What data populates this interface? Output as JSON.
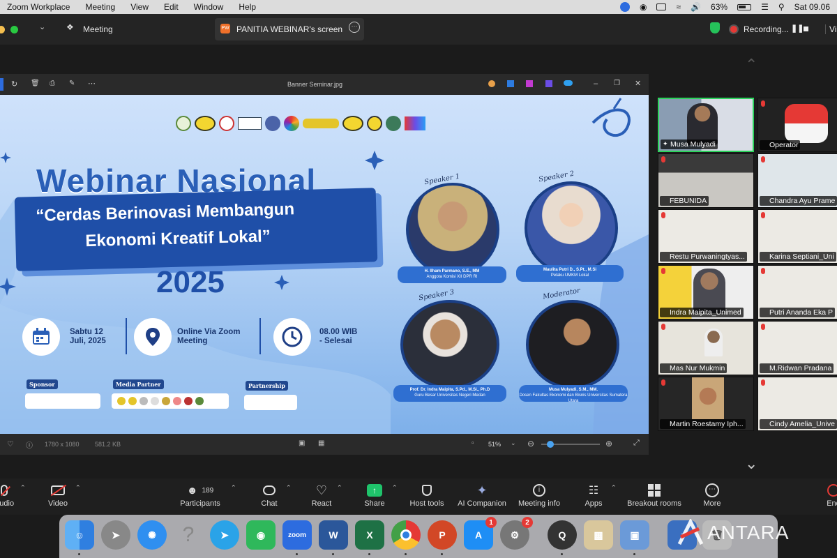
{
  "menubar": {
    "items": [
      "Zoom Workplace",
      "Meeting",
      "View",
      "Edit",
      "Window",
      "Help"
    ],
    "battery": "63%",
    "clock": "Sat 09.06"
  },
  "titlebar": {
    "meeting_label": "Meeting",
    "share_tab": "PANITIA WEBINAR's screen",
    "share_tab_avatar": "PW",
    "recording": "Recording...",
    "view": "View"
  },
  "viewer": {
    "filename": "Banner Seminar.jpg",
    "dimensions": "1780 x 1080",
    "filesize": "581.2 KB",
    "zoom": "51%"
  },
  "banner": {
    "title": "Webinar Nasional",
    "theme_line1": "“Cerdas Berinovasi Membangun",
    "theme_line2": "Ekonomi Kreatif Lokal”",
    "year": "2025",
    "date_line1": "Sabtu 12",
    "date_line2": "Juli, 2025",
    "venue_line1": "Online Via Zoom",
    "venue_line2": "Meeting",
    "time_line1": "08.00 WIB",
    "time_line2": "- Selesai",
    "sponsor_label": "Sponsor",
    "media_label": "Media Partner",
    "partnership_label": "Partnership",
    "speakers": [
      {
        "tag": "Speaker 1",
        "name": "H. Ilham Parmano, S.E., MM",
        "role": "Anggota Komisi XII DPR RI"
      },
      {
        "tag": "Speaker 2",
        "name": "Maulita Putri D., S.Pt., M.Si",
        "role": "Pelaku UMKM Lokal"
      },
      {
        "tag": "Speaker 3",
        "name": "Prof. Dr. Indra Maipita, S.Pd., M.Si., Ph.D",
        "role": "Guru Besar Universitas Negeri Medan"
      },
      {
        "tag": "Moderator",
        "name": "Musa Mulyadi, S.M., MM.",
        "role": "Dosen Fakultas Ekonomi dan Bisnis Universitas Sumatera Utara"
      }
    ]
  },
  "gallery": [
    {
      "name": "Musa Mulyadi"
    },
    {
      "name": "Operator"
    },
    {
      "name": "FEBUNIDA"
    },
    {
      "name": "Chandra Ayu Prame"
    },
    {
      "name": "Restu Purwaningtyas..."
    },
    {
      "name": "Karina Septiani_Uni"
    },
    {
      "name": "Indra Maipita_Unimed"
    },
    {
      "name": "Putri Ananda Eka P"
    },
    {
      "name": "Mas Nur Mukmin"
    },
    {
      "name": "M.Ridwan Pradana"
    },
    {
      "name": "Martin Roestamy Iph..."
    },
    {
      "name": "Cindy Amelia_Unive"
    }
  ],
  "toolbar": {
    "audio": "Audio",
    "video": "Video",
    "participants": "Participants",
    "participants_count": "189",
    "chat": "Chat",
    "react": "React",
    "share": "Share",
    "host_tools": "Host tools",
    "ai_companion": "AI Companion",
    "meeting_info": "Meeting info",
    "apps": "Apps",
    "breakout": "Breakout rooms",
    "more": "More",
    "end": "End"
  },
  "dock": {
    "zoom_label": "zoom",
    "appstore_badge": "1",
    "settings_badge": "2"
  },
  "watermark": "ANTARA",
  "colors": {
    "accent": "#2d6cdf",
    "share_green": "#1fc36b",
    "record_red": "#e53935",
    "banner_blue": "#2a5fb7"
  }
}
